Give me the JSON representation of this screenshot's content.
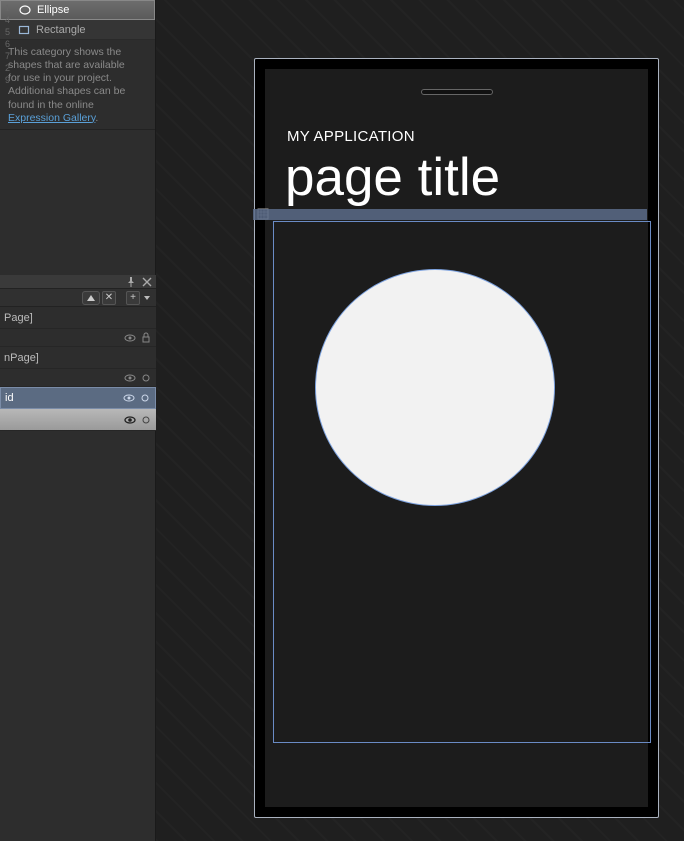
{
  "shapes": {
    "items": [
      {
        "name": "Ellipse",
        "selected": true
      },
      {
        "name": "Rectangle",
        "selected": false
      }
    ],
    "help_line1": "This category shows the",
    "help_line2": "shapes that are available",
    "help_line3": "for use in your project.",
    "help_line4": "Additional shapes can be",
    "help_line5": "found in the online",
    "help_link": "Expression Gallery",
    "help_period": ".",
    "gutter": [
      "",
      "1",
      "",
      "",
      "4",
      "5",
      "6",
      "7",
      "",
      "2",
      "",
      "",
      "",
      "",
      "9"
    ]
  },
  "panel2": {
    "items": [
      {
        "label": "Page]",
        "visible": true
      },
      {
        "label": "nPage]",
        "visible": true
      },
      {
        "label": "id",
        "visible": true,
        "selected": true
      },
      {
        "label": "",
        "visible": true,
        "highlight": true
      }
    ]
  },
  "phone": {
    "app_title": "MY APPLICATION",
    "page_title": "page title"
  }
}
